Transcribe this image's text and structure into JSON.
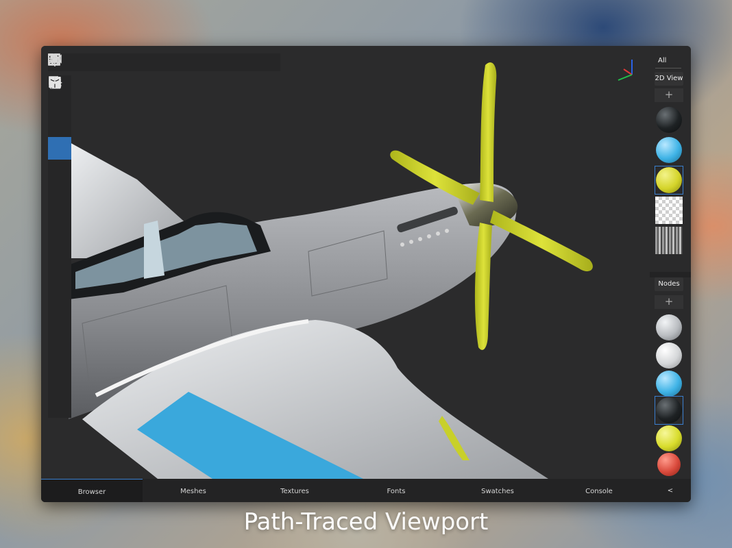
{
  "top_toolbar": {
    "icons": [
      "menu-icon",
      "grid-icon",
      "import-icon",
      "export-icon",
      "image-icon",
      "settings-icon",
      "video-camera-icon",
      "help-icon",
      "undo-icon"
    ]
  },
  "left_toolbar": {
    "expand_label": ">",
    "tools": [
      "brush-icon",
      "eraser-icon",
      "fill-icon",
      "sticker-icon",
      "text-icon",
      "transform-icon",
      "contrast-icon",
      "smudge-icon",
      "splatter-icon",
      "depth-icon",
      "color-picker-icon",
      "adjust-icon",
      "material-icon",
      "axis-icon"
    ],
    "active_tool": "fill-icon"
  },
  "right_panel": {
    "filter_value": "All",
    "view_button": "2D View",
    "plus": "+",
    "nodes_button": "Nodes",
    "textures": [
      {
        "kind": "ball",
        "color": "#1e2224"
      },
      {
        "kind": "ball",
        "color": "#3fb3e6"
      },
      {
        "kind": "ball",
        "color": "#d4d42a",
        "selected": true
      },
      {
        "kind": "checker"
      },
      {
        "kind": "noise"
      }
    ],
    "materials": [
      {
        "kind": "ball",
        "color": "#b9bcc0"
      },
      {
        "kind": "ball",
        "color": "#d4d6d8"
      },
      {
        "kind": "ball",
        "color": "#3fb3e6"
      },
      {
        "kind": "ball",
        "color": "#1e2224",
        "selected": true
      },
      {
        "kind": "ball",
        "color": "#d8dc2c"
      },
      {
        "kind": "ball",
        "color": "#d94a3c"
      }
    ]
  },
  "bottom_tabs": {
    "tabs": [
      "Browser",
      "Meshes",
      "Textures",
      "Fonts",
      "Swatches",
      "Console"
    ],
    "active": "Browser",
    "collapse": "<"
  },
  "caption": {
    "bold": "Path-Traced",
    "light": "Viewport"
  },
  "colors": {
    "accent": "#2f6fb3",
    "propeller": "#c8d02a",
    "fuselage": "#8d8f93",
    "stripe": "#3aa8dc"
  }
}
